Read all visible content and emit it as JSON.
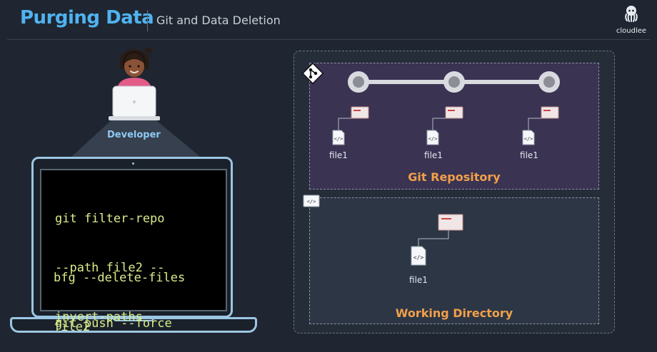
{
  "header": {
    "title": "Purging Data",
    "subtitle": "Git and Data Deletion",
    "brand": "cloudlee"
  },
  "developer": {
    "label": "Developer"
  },
  "terminal": {
    "commands": [
      [
        "git filter-repo",
        "--path file2 --",
        "invert-paths"
      ],
      [
        "bfg --delete-files",
        "file2"
      ],
      [
        "git push --force"
      ]
    ]
  },
  "git_repository": {
    "label": "Git Repository",
    "commits": [
      {
        "file": "file1"
      },
      {
        "file": "file1"
      },
      {
        "file": "file1"
      }
    ]
  },
  "working_directory": {
    "label": "Working Directory",
    "file": "file1"
  },
  "colors": {
    "title": "#4fb3f0",
    "accent_label": "#f2a04a",
    "code": "#d9ec8a",
    "repo_bg": "#3a3352",
    "wd_bg": "#2d3645"
  }
}
